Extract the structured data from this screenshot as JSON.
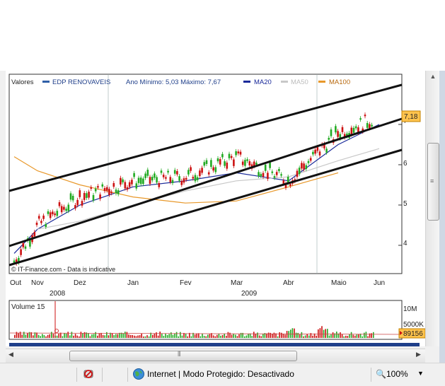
{
  "chart": {
    "legend": {
      "label": "Valores",
      "series_name": "EDP RENOVAVEIS",
      "range_text": "Ano Mínimo: 5,03 Máximo: 7,67",
      "ma20": "MA20",
      "ma50": "MA50",
      "ma100": "MA100"
    },
    "copyright": "© IT-Finance.com - Data is indicative",
    "last_price": "7,18",
    "months": [
      "Out",
      "Nov",
      "Dez",
      "Jan",
      "Fev",
      "Mar",
      "Abr",
      "Maio",
      "Jun"
    ],
    "years": [
      "2008",
      "2009"
    ],
    "y_ticks": [
      "4",
      "5",
      "6",
      "7"
    ],
    "volume": {
      "label": "Volume 15",
      "ticks": [
        "10M",
        "5000K"
      ],
      "last": "89156"
    },
    "colors": {
      "up": "#22aa22",
      "down": "#cc1111",
      "ma20": "#1a2a9a",
      "ma50": "#c8c8c8",
      "ma100": "#e8982a",
      "badge": "#ffc34d"
    }
  },
  "chart_data": {
    "type": "line",
    "ylim": [
      3.5,
      8.0
    ],
    "series": [
      {
        "name": "EDP RENOVAVEIS",
        "x": [
          "Out",
          "Nov",
          "Dez",
          "Jan",
          "Fev",
          "Mar",
          "Abr",
          "Maio",
          "Jun"
        ],
        "values": [
          3.6,
          4.5,
          5.2,
          5.6,
          5.7,
          6.2,
          5.6,
          6.8,
          7.18
        ]
      },
      {
        "name": "MA20",
        "x": [
          "Out",
          "Nov",
          "Dez",
          "Jan",
          "Fev",
          "Mar",
          "Abr",
          "Maio",
          "Jun"
        ],
        "values": [
          3.8,
          4.4,
          5.0,
          5.45,
          5.6,
          5.8,
          5.6,
          6.5,
          7.0
        ]
      },
      {
        "name": "MA50",
        "x": [
          "Nov",
          "Dez",
          "Jan",
          "Fev",
          "Mar",
          "Abr",
          "Maio",
          "Jun"
        ],
        "values": [
          4.4,
          4.6,
          5.0,
          5.35,
          5.6,
          5.7,
          6.1,
          6.4
        ]
      },
      {
        "name": "MA100",
        "x": [
          "Out",
          "Nov",
          "Dez",
          "Jan",
          "Fev",
          "Mar",
          "Abr",
          "Maio"
        ],
        "values": [
          6.2,
          5.85,
          5.5,
          5.2,
          5.05,
          5.1,
          5.45,
          5.8
        ]
      }
    ]
  },
  "statusbar": {
    "zone": "Internet | Modo Protegido: Desactivado",
    "zoom": "100%"
  }
}
